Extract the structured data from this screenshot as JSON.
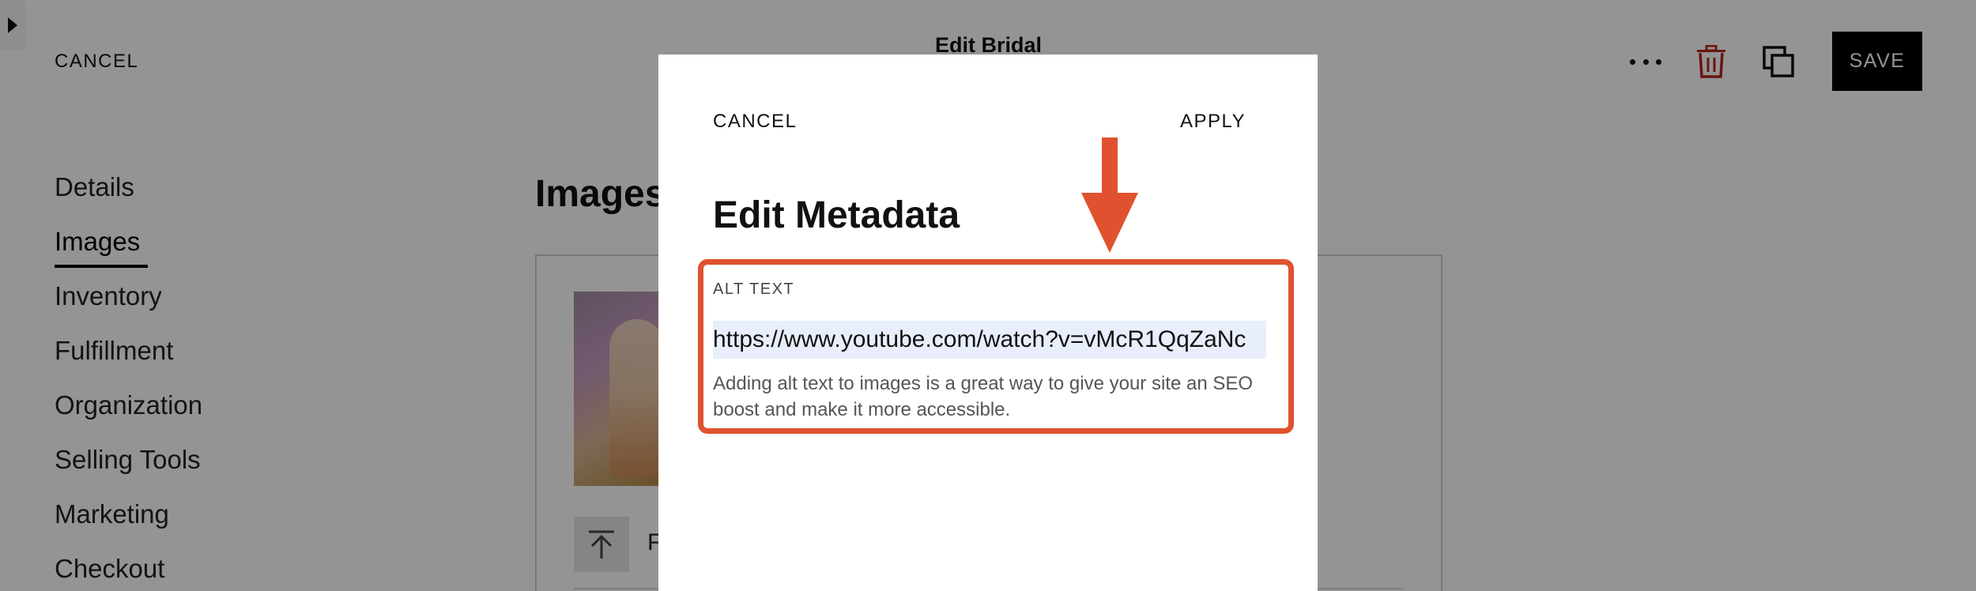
{
  "page": {
    "title": "Edit Bridal",
    "cancel_label": "CANCEL",
    "save_label": "SAVE",
    "section_title": "Images",
    "upload_label_fragment": "F"
  },
  "nav": {
    "items": [
      {
        "label": "Details"
      },
      {
        "label": "Images",
        "active": true
      },
      {
        "label": "Inventory"
      },
      {
        "label": "Fulfillment"
      },
      {
        "label": "Organization"
      },
      {
        "label": "Selling Tools"
      },
      {
        "label": "Marketing"
      },
      {
        "label": "Checkout"
      }
    ]
  },
  "modal": {
    "cancel_label": "CANCEL",
    "apply_label": "APPLY",
    "title": "Edit Metadata",
    "alt_text_label": "ALT TEXT",
    "alt_text_value": "https://www.youtube.com/watch?v=vMcR1QqZaNc",
    "helper_text": "Adding alt text to images is a great way to give your site an SEO boost and make it more accessible."
  },
  "icons": {
    "more": "more-horizontal-icon",
    "trash": "trash-icon",
    "duplicate": "duplicate-icon",
    "upload": "upload-icon",
    "sidebar_toggle": "caret-right-icon",
    "annotation_arrow": "arrow-down-icon"
  },
  "colors": {
    "annotation": "#e0522f",
    "trash": "#b3261e",
    "save_bg": "#000000",
    "overlay": "rgba(0,0,0,0.42)"
  }
}
